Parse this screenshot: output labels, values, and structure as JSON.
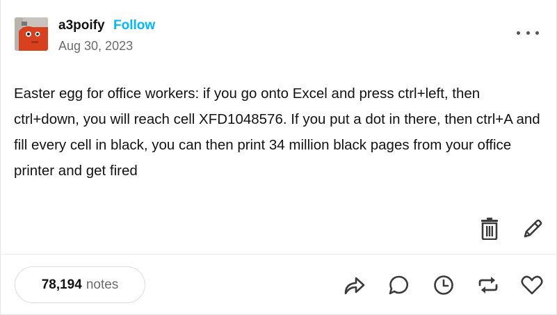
{
  "post": {
    "author": {
      "username": "a3poify",
      "follow_label": "Follow",
      "avatar_icon": "avatar-photo"
    },
    "date": "Aug 30, 2023",
    "more_icon": "more-horizontal-icon",
    "text": "Easter egg for office workers: if you go onto Excel and press ctrl+left, then ctrl+down, you will reach cell XFD1048576. If you put a dot in there, then ctrl+A and fill every cell in black, you can then print 34 million black pages from your office printer and get fired",
    "owner_tools": [
      "trash-icon",
      "pencil-icon"
    ],
    "footer": {
      "notes_count": "78,194",
      "notes_label": "notes",
      "actions": [
        "share-icon",
        "reply-icon",
        "queue-icon",
        "reblog-icon",
        "like-icon"
      ]
    }
  },
  "colors": {
    "follow": "#00b8ff",
    "text": "#121212",
    "muted": "#6b6b6b",
    "icon": "#3a3a3a",
    "avatar_bg": "#d9411e"
  }
}
